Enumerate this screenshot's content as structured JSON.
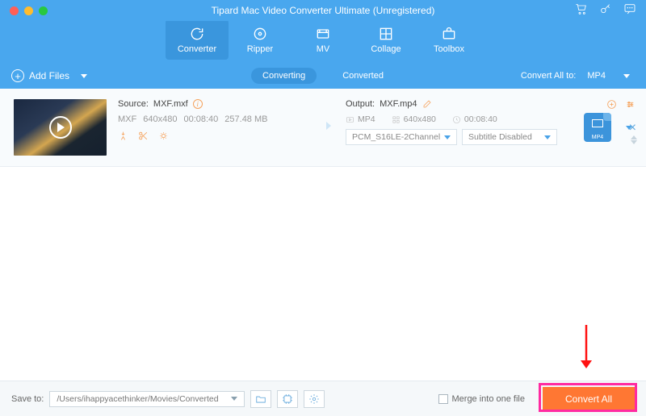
{
  "title": "Tipard Mac Video Converter Ultimate (Unregistered)",
  "tabs": [
    {
      "label": "Converter"
    },
    {
      "label": "Ripper"
    },
    {
      "label": "MV"
    },
    {
      "label": "Collage"
    },
    {
      "label": "Toolbox"
    }
  ],
  "add_files": "Add Files",
  "subtabs": {
    "converting": "Converting",
    "converted": "Converted"
  },
  "convert_all_to": {
    "label": "Convert All to:",
    "value": "MP4"
  },
  "file": {
    "source_label": "Source:",
    "source_name": "MXF.mxf",
    "codec": "MXF",
    "resolution": "640x480",
    "duration": "00:08:40",
    "size": "257.48 MB",
    "output_label": "Output:",
    "output_name": "MXF.mp4",
    "out_format": "MP4",
    "out_resolution": "640x480",
    "out_duration": "00:08:40",
    "audio_sel": "PCM_S16LE-2Channel",
    "subtitle_sel": "Subtitle Disabled",
    "badge_format": "MP4"
  },
  "bottom": {
    "save_to": "Save to:",
    "path": "/Users/ihappyacethinker/Movies/Converted",
    "merge": "Merge into one file",
    "convert_all": "Convert All"
  }
}
